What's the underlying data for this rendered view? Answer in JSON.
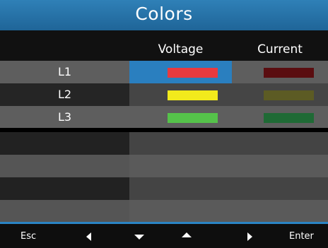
{
  "title": "Colors",
  "columns": {
    "voltage": "Voltage",
    "current": "Current"
  },
  "rows": [
    {
      "label": "L1",
      "voltage_color": "#e83a3f",
      "current_color": "#5a0d10",
      "selected": "voltage"
    },
    {
      "label": "L2",
      "voltage_color": "#f2ea1c",
      "current_color": "#5c5b24",
      "selected": null
    },
    {
      "label": "L3",
      "voltage_color": "#55c24a",
      "current_color": "#1f6a35",
      "selected": null
    }
  ],
  "footer": {
    "esc": "Esc",
    "enter": "Enter"
  },
  "colors": {
    "accent": "#2b84c4",
    "selected_cell": "#2a7fbf"
  },
  "icons": {
    "left": "triangle-left-icon",
    "down": "triangle-down-icon",
    "up": "triangle-up-icon",
    "right": "triangle-right-icon"
  }
}
